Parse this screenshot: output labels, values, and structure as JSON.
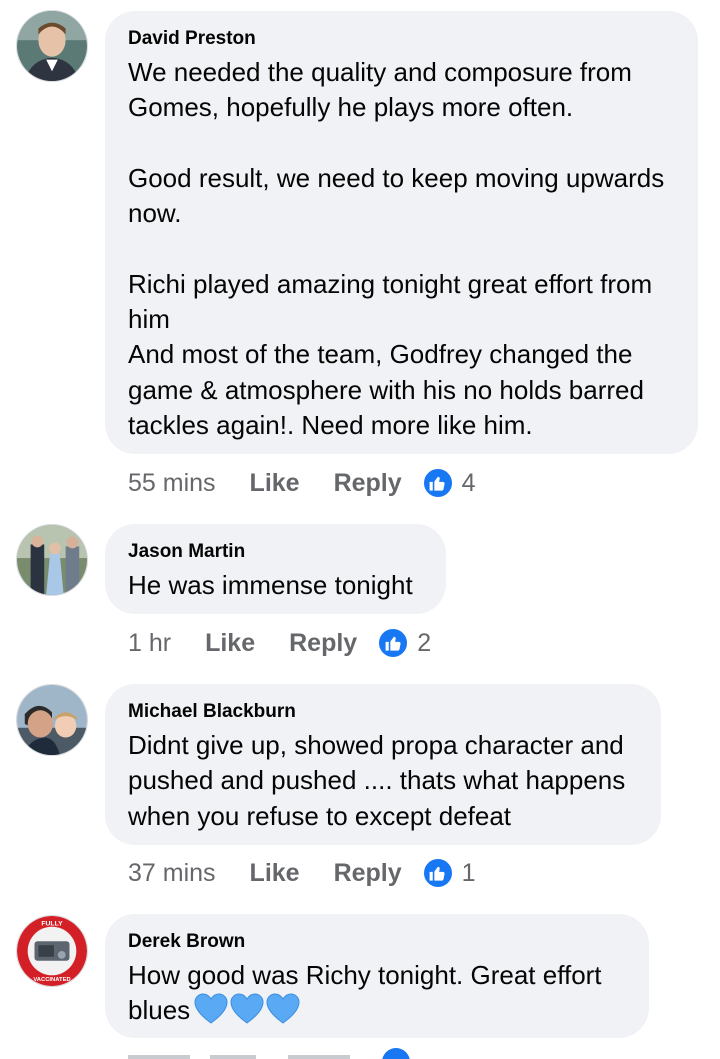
{
  "comments": [
    {
      "author": "David Preston",
      "text": "We needed the quality and composure from Gomes, hopefully he plays more often.\n\nGood result, we need to keep moving upwards now.\n\nRichi played amazing tonight great effort from him\nAnd most of the team, Godfrey changed the game & atmosphere with his no holds barred tackles again!. Need more like him.",
      "time": "55 mins",
      "like_label": "Like",
      "reply_label": "Reply",
      "reactions": "4"
    },
    {
      "author": "Jason Martin",
      "text": "He was immense tonight",
      "time": "1 hr",
      "like_label": "Like",
      "reply_label": "Reply",
      "reactions": "2"
    },
    {
      "author": "Michael Blackburn",
      "text": "Didnt give up, showed propa character and pushed and pushed .... thats what happens when you refuse to except defeat",
      "time": "37 mins",
      "like_label": "Like",
      "reply_label": "Reply",
      "reactions": "1"
    },
    {
      "author": "Derek Brown",
      "text": "How good was Richy tonight.  Great effort blues",
      "emoji": [
        "blue-heart",
        "blue-heart",
        "blue-heart"
      ],
      "badge_text_top": "FULLY",
      "badge_text_bottom": "VACCINATED"
    }
  ],
  "colors": {
    "bubble": "#f0f2f5",
    "meta_text": "#65676b",
    "like_blue": "#1877f2",
    "heart_blue": "#5aa9f5"
  },
  "icons": {
    "reaction": "thumbs-up-icon",
    "emoji": "blue-heart-icon"
  }
}
